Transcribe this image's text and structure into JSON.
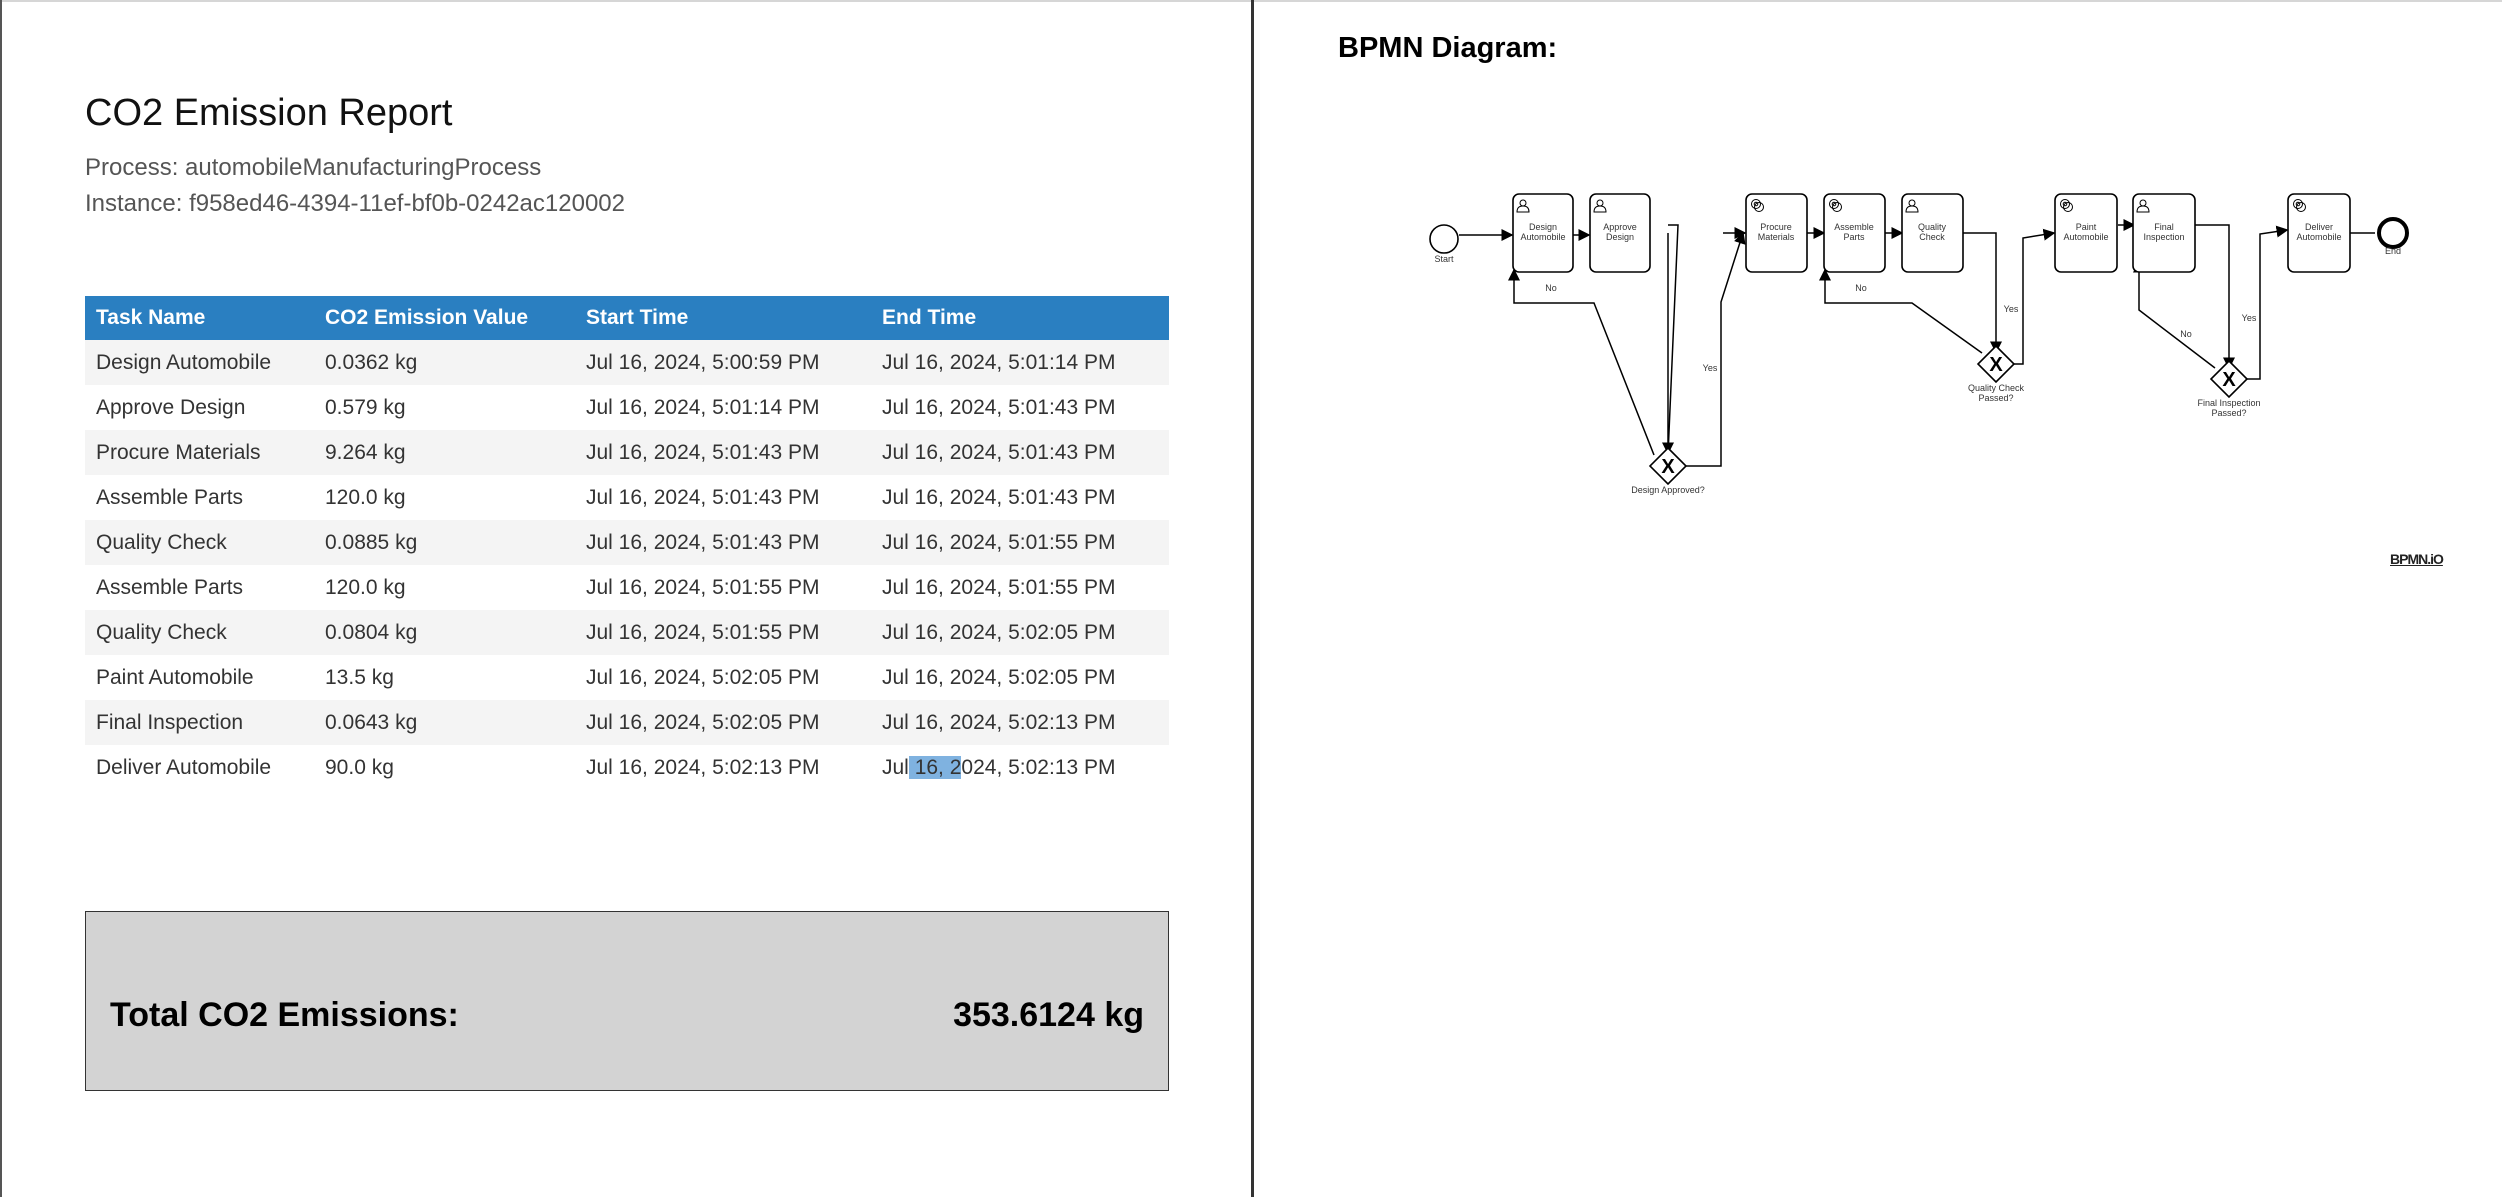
{
  "report": {
    "title": "CO2 Emission Report",
    "process": "Process: automobileManufacturingProcess",
    "instance": "Instance: f958ed46-4394-11ef-bf0b-0242ac120002"
  },
  "table": {
    "headers": [
      "Task Name",
      "CO2 Emission Value",
      "Start Time",
      "End Time"
    ],
    "rows": [
      [
        "Design Automobile",
        "0.0362 kg",
        "Jul 16, 2024, 5:00:59 PM",
        "Jul 16, 2024, 5:01:14 PM"
      ],
      [
        "Approve Design",
        "0.579 kg",
        "Jul 16, 2024, 5:01:14 PM",
        "Jul 16, 2024, 5:01:43 PM"
      ],
      [
        "Procure Materials",
        "9.264 kg",
        "Jul 16, 2024, 5:01:43 PM",
        "Jul 16, 2024, 5:01:43 PM"
      ],
      [
        "Assemble Parts",
        "120.0 kg",
        "Jul 16, 2024, 5:01:43 PM",
        "Jul 16, 2024, 5:01:43 PM"
      ],
      [
        "Quality Check",
        "0.0885 kg",
        "Jul 16, 2024, 5:01:43 PM",
        "Jul 16, 2024, 5:01:55 PM"
      ],
      [
        "Assemble Parts",
        "120.0 kg",
        "Jul 16, 2024, 5:01:55 PM",
        "Jul 16, 2024, 5:01:55 PM"
      ],
      [
        "Quality Check",
        "0.0804 kg",
        "Jul 16, 2024, 5:01:55 PM",
        "Jul 16, 2024, 5:02:05 PM"
      ],
      [
        "Paint Automobile",
        "13.5 kg",
        "Jul 16, 2024, 5:02:05 PM",
        "Jul 16, 2024, 5:02:05 PM"
      ],
      [
        "Final Inspection",
        "0.0643 kg",
        "Jul 16, 2024, 5:02:05 PM",
        "Jul 16, 2024, 5:02:13 PM"
      ],
      [
        "Deliver Automobile",
        "90.0 kg",
        "Jul 16, 2024, 5:02:13 PM",
        "Jul 16, 2024, 5:02:13 PM"
      ]
    ],
    "last_end_parts": [
      "Jul",
      " 16, 2",
      "024, 5:02:13 PM"
    ]
  },
  "total": {
    "label": "Total CO2 Emissions:",
    "value": "353.6124 kg"
  },
  "bpmn": {
    "title": "BPMN Diagram:",
    "watermark": "BPMN.iO",
    "start_label": "Start",
    "end_label": "End",
    "tasks": [
      {
        "line1": "Design",
        "line2": "Automobile",
        "icon": "user-icon"
      },
      {
        "line1": "Approve",
        "line2": "Design",
        "icon": "user-icon"
      },
      {
        "line1": "Procure",
        "line2": "Materials",
        "icon": "gear-icon"
      },
      {
        "line1": "Assemble",
        "line2": "Parts",
        "icon": "gear-icon"
      },
      {
        "line1": "Quality",
        "line2": "Check",
        "icon": "user-icon"
      },
      {
        "line1": "Paint",
        "line2": "Automobile",
        "icon": "gear-icon"
      },
      {
        "line1": "Final",
        "line2": "Inspection",
        "icon": "user-icon"
      },
      {
        "line1": "Deliver",
        "line2": "Automobile",
        "icon": "gear-icon"
      }
    ],
    "gateways": [
      {
        "line1": "Design Approved?",
        "line2": ""
      },
      {
        "line1": "Quality Check",
        "line2": "Passed?"
      },
      {
        "line1": "Final Inspection",
        "line2": "Passed?"
      }
    ],
    "flow_labels": {
      "yes": "Yes",
      "no": "No"
    }
  }
}
